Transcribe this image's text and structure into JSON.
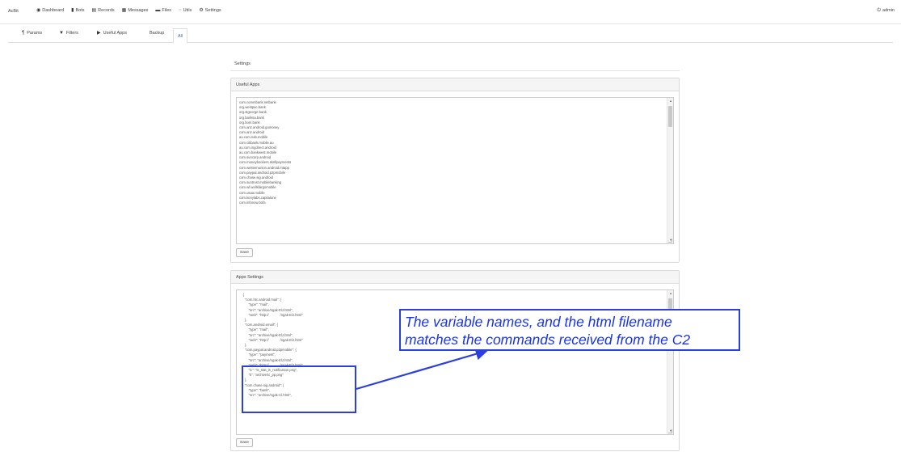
{
  "topnav": {
    "brand": "AcBit",
    "items": [
      {
        "label": "Dashboard",
        "icon": "dashboard-icon",
        "glyph": "◉"
      },
      {
        "label": "Bots",
        "icon": "bots-icon",
        "glyph": "▮"
      },
      {
        "label": "Records",
        "icon": "records-icon",
        "glyph": "▤"
      },
      {
        "label": "Messages",
        "icon": "messages-icon",
        "glyph": "▦"
      },
      {
        "label": "Files",
        "icon": "files-icon",
        "glyph": "▬"
      },
      {
        "label": "Utils",
        "icon": "utils-icon",
        "glyph": "○"
      },
      {
        "label": "Settings",
        "icon": "settings-icon",
        "glyph": "⚙"
      }
    ],
    "user": {
      "label": "admin",
      "glyph": "⏻"
    }
  },
  "subtabs": [
    {
      "label": "Params",
      "icon": "paragraph-icon",
      "glyph": "¶"
    },
    {
      "label": "Filters",
      "icon": "filter-icon",
      "glyph": "▼"
    },
    {
      "label": "Useful Apps",
      "icon": "video-icon",
      "glyph": "▶"
    },
    {
      "label": "Backup",
      "icon": "",
      "glyph": ""
    },
    {
      "label": "All",
      "icon": "",
      "glyph": ""
    }
  ],
  "settings_title": "Settings",
  "useful_apps": {
    "heading": "Useful Apps",
    "lines": "com.commbank.netbank\norg.westpac.bank\norg.stgeorge.bank\norg.banksa.bank\norg.bom.bank\ncom.anz.android.gomoney\ncom.anz.android\nau.com.nab.mobile\ncom.citibank.mobile.au\nau.com.ingdirect.android\nau.com.bankwest.mobile\ncom.suncorp.android\ncom.moneybookers.skrillpayments\ncom.westernunion.android.mtapp\ncom.paypal.android.p2pmobile\ncom.chase.sig.android\ncom.suntrust.mobilebanking\ncom.wf.wellsfargomobile\ncom.usaa.mobile\ncom.konylabs.capitalone\ncom.infonow.bofa",
    "save_label": "Save"
  },
  "apps_settings": {
    "heading": "Apps Settings",
    "lines": "    {\n      \"com.htc.android.mail\": {\n          \"type\": \"mail\",\n          \"src\": \"archive/ngak-ElJ.html\",\n          \"web\": \"http://            /ngak-ElJ.html\"\n      },\n      \"com.android.email\": {\n          \"type\": \"mail\",\n          \"src\": \"archive/ngak-ElJ.html\",\n          \"web\": \"http://            /ngak-ElJ.html\"\n      },\n      \"com.paypal.android.p2pmobile\": {\n          \"type\": \"payment\",\n          \"src\": \"archive/ngak-ElJ.html\",\n          \"web\": \"http://            /ngak-ElJ.html\",\n          \"ic\": \"is_stat_is_notification.png\",\n          \"ti\": \"archive/ic_pp.png\"\n      },\n      \"com.chase.sig.android\": {\n          \"type\": \"bank\",\n          \"src\": \"archive/ngak-Cl.html\",",
    "save_label": "Save"
  },
  "annotation": {
    "line1": "The variable names, and the html filename",
    "line2": "matches the commands received from the C2",
    "color": "#2b3fe0"
  }
}
